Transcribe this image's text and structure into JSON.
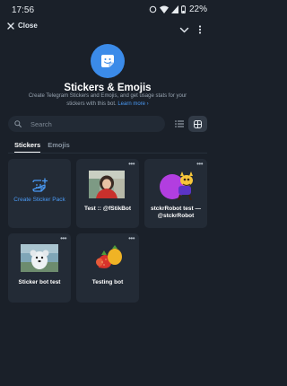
{
  "status_bar": {
    "time": "17:56",
    "battery": "22%"
  },
  "top_bar": {
    "close_label": "Close"
  },
  "header": {
    "title": "Stickers & Emojis",
    "description": "Create Telegram Stickers and Emojis, and get usage stats for your stickers with this bot.",
    "learn_more": "Learn more ›"
  },
  "search": {
    "placeholder": "Search"
  },
  "tabs": [
    {
      "label": "Stickers",
      "active": true
    },
    {
      "label": "Emojis",
      "active": false
    }
  ],
  "create_card": {
    "label": "Create Sticker Pack"
  },
  "packs": [
    {
      "title": "Test :: @fStikBot",
      "thumbnail": "girl-in-red-sweater-photo"
    },
    {
      "title": "stckrRobot test — @stckrRobot",
      "thumbnail": "purple-cat-dancing-sticker"
    },
    {
      "title": "Sticker bot test",
      "thumbnail": "white-dog-toy-photo"
    },
    {
      "title": "Testing bot",
      "thumbnail": "strawberry-fruits-sticker"
    }
  ],
  "colors": {
    "background": "#1a2029",
    "card": "#232b36",
    "accent": "#3b8be9",
    "link": "#4a9af5"
  },
  "icons": [
    "close-icon",
    "chevron-down-icon",
    "kebab-menu-icon",
    "sticker-bot-icon",
    "search-icon",
    "list-view-icon",
    "grid-view-icon",
    "add-sticker-icon"
  ]
}
